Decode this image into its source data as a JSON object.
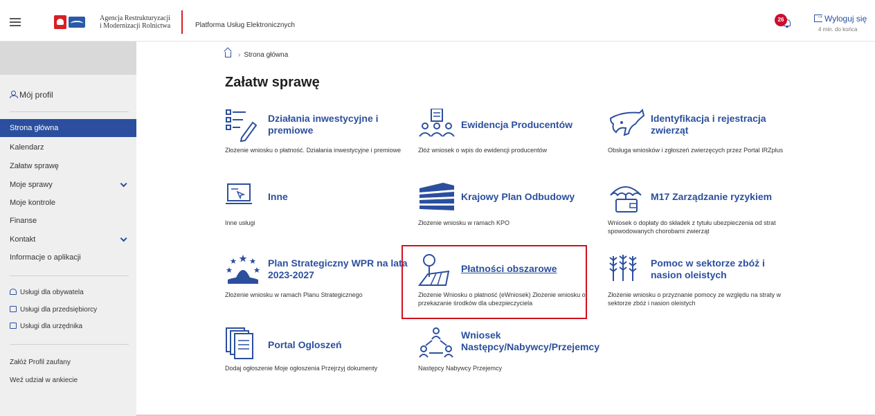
{
  "header": {
    "menu_icon": "hamburger-icon",
    "logo_line1": "Agencja Restrukturyzacji",
    "logo_line2": "i Modernizacji Rolnictwa",
    "platform_title": "Platforma Usług Elektronicznych",
    "notification_count": "26",
    "logout_label": "Wyloguj się",
    "session_remaining": "4 min. do końca"
  },
  "sidebar": {
    "profile_label": "Mój profil",
    "nav": [
      {
        "label": "Strona główna",
        "active": true
      },
      {
        "label": "Kalendarz"
      },
      {
        "label": "Załatw sprawę"
      },
      {
        "label": "Moje sprawy",
        "expandable": true
      },
      {
        "label": "Moje kontrole"
      },
      {
        "label": "Finanse"
      },
      {
        "label": "Kontakt",
        "expandable": true
      },
      {
        "label": "Informacje o aplikacji"
      }
    ],
    "services": [
      {
        "label": "Usługi dla obywatela",
        "icon": "person-icon"
      },
      {
        "label": "Usługi dla przedsiębiorcy",
        "icon": "briefcase-icon"
      },
      {
        "label": "Usługi dla urzędnika",
        "icon": "monitor-icon"
      }
    ],
    "links": [
      {
        "label": "Załóż Profil zaufany"
      },
      {
        "label": "Weź udział w ankiecie"
      }
    ]
  },
  "main": {
    "breadcrumb": {
      "home_icon": "home-icon",
      "current": "Strona główna"
    },
    "title": "Załatw sprawę",
    "tiles": [
      {
        "title": "Działania inwestycyjne i premiowe",
        "desc": "Złożenie wniosku o płatność. Działania inwestycyjne i premiowe",
        "icon": "list-pencil-icon"
      },
      {
        "title": "Ewidencja Producentów",
        "desc": "Złóż wniosek o wpis do ewidencji producentów",
        "icon": "people-document-icon"
      },
      {
        "title": "Identyfikacja i rejestracja zwierząt",
        "desc": "Obsługa wniosków i zgłoszeń zwierzęcych przez Portal IRZplus",
        "icon": "cow-icon"
      },
      {
        "title": "Inne",
        "desc": "Inne usługi",
        "icon": "laptop-icon"
      },
      {
        "title": "Krajowy Plan Odbudowy",
        "desc": "Złożenie wniosku w ramach KPO",
        "icon": "kpo-icon"
      },
      {
        "title": "M17 Zarządzanie ryzykiem",
        "desc": "Wniosek o dopłaty do składek z tytułu ubezpieczenia od strat spowodowanych chorobami zwierząt",
        "icon": "umbrella-wallet-icon"
      },
      {
        "title": "Plan Strategiczny WPR na lata 2023-2027",
        "desc": "Złożenie wniosku w ramach Planu Strategicznego",
        "icon": "eu-stars-icon"
      },
      {
        "title": "Płatności obszarowe",
        "desc": "Złożenie Wniosku o płatność (eWniosek) Złożenie wniosku o przekazanie środków dla ubezpieczyciela",
        "icon": "field-tree-icon",
        "highlighted": true
      },
      {
        "title": "Pomoc w sektorze zbóż i nasion oleistych",
        "desc": "Złożenie wniosku o przyznanie pomocy ze względu na straty w sektorze zbóż i nasion oleistych",
        "icon": "wheat-icon"
      },
      {
        "title": "Portal Ogloszeń",
        "desc": "Dodaj ogłoszenie Moje ogłoszenia Przejrzyj dokumenty",
        "icon": "documents-icon"
      },
      {
        "title": "Wniosek Następcy/Nabywcy/Przejemcy",
        "desc": "Następcy Nabywcy Przejemcy",
        "icon": "people-network-icon"
      }
    ]
  },
  "colors": {
    "brand_blue": "#2b4f9e",
    "accent_red": "#d0101e",
    "sidebar_bg": "#efefef"
  }
}
